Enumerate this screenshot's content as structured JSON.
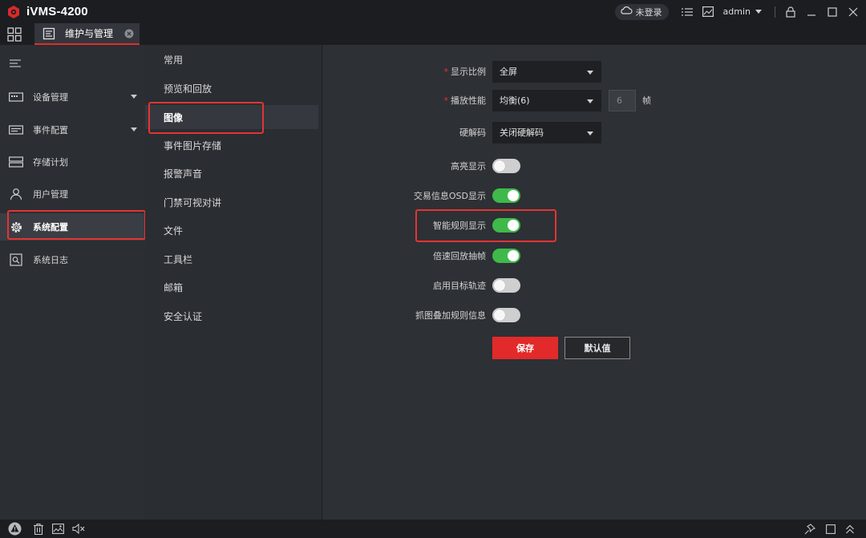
{
  "app": {
    "title": "iVMS-4200",
    "brand_color": "#e32b2b"
  },
  "titlebar": {
    "login_status": "未登录",
    "user": "admin",
    "icons": [
      "cloud-icon",
      "list-icon",
      "image-icon",
      "lock-icon",
      "minimize-icon",
      "maximize-icon",
      "close-icon"
    ]
  },
  "tabbar": {
    "active_tab": "维护与管理"
  },
  "leftnav": {
    "items": [
      {
        "label": "设备管理",
        "icon": "device-icon",
        "expandable": true
      },
      {
        "label": "事件配置",
        "icon": "event-icon",
        "expandable": true
      },
      {
        "label": "存储计划",
        "icon": "storage-icon",
        "expandable": false
      },
      {
        "label": "用户管理",
        "icon": "user-icon",
        "expandable": false
      },
      {
        "label": "系统配置",
        "icon": "gear-icon",
        "expandable": false,
        "active": true
      },
      {
        "label": "系统日志",
        "icon": "log-icon",
        "expandable": false
      }
    ]
  },
  "submenu": {
    "items": [
      "常用",
      "预览和回放",
      "图像",
      "事件图片存储",
      "报警声音",
      "门禁可视对讲",
      "文件",
      "工具栏",
      "邮箱",
      "安全认证"
    ],
    "active": "图像"
  },
  "form": {
    "display_ratio": {
      "label": "显示比例",
      "required": true,
      "value": "全屏"
    },
    "playback_perf": {
      "label": "播放性能",
      "required": true,
      "value": "均衡(6)",
      "frames": "6",
      "unit": "帧"
    },
    "hw_decode": {
      "label": "硬解码",
      "value": "关闭硬解码"
    },
    "toggles": [
      {
        "label": "高亮显示",
        "on": false
      },
      {
        "label": "交易信息OSD显示",
        "on": true
      },
      {
        "label": "智能规则显示",
        "on": true
      },
      {
        "label": "倍速回放抽帧",
        "on": true
      },
      {
        "label": "启用目标轨迹",
        "on": false
      },
      {
        "label": "抓图叠加规则信息",
        "on": false
      }
    ],
    "save_label": "保存",
    "default_label": "默认值"
  },
  "colors": {
    "toggle_on": "#3fb94a",
    "highlight_box": "#e53333"
  }
}
